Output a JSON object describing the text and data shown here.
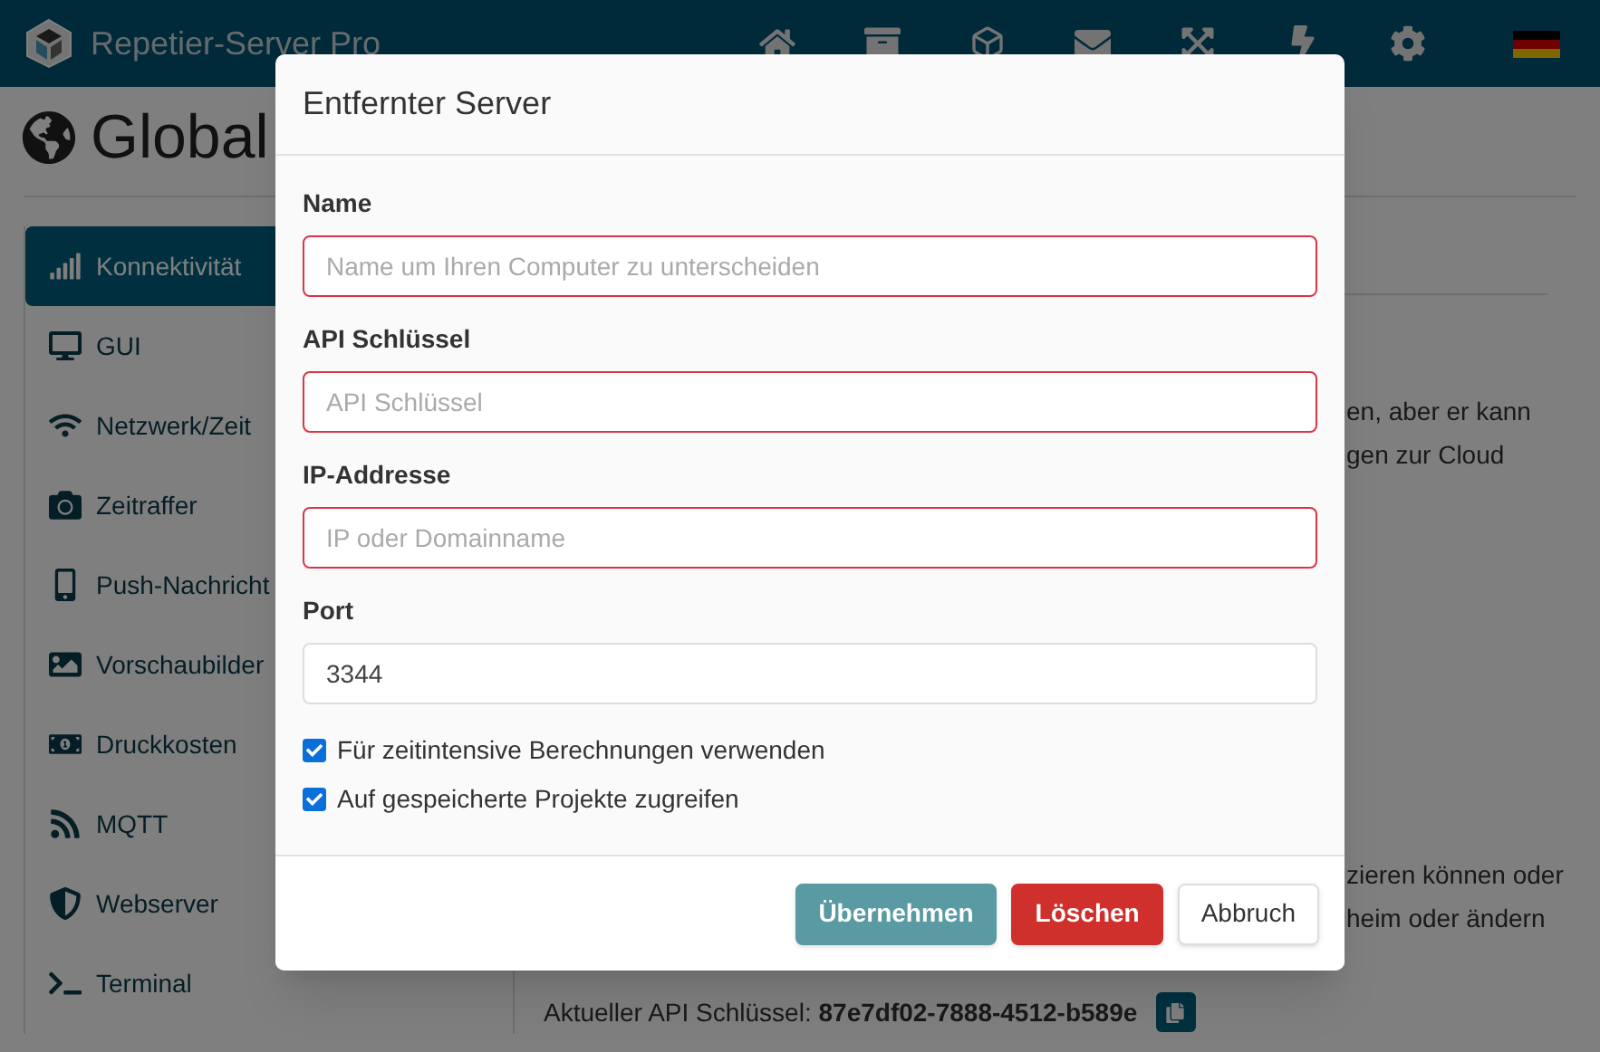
{
  "header": {
    "title": "Repetier-Server Pro"
  },
  "page_title": "Global",
  "sidebar": {
    "items": [
      {
        "label": "Konnektivität",
        "selected": true
      },
      {
        "label": "GUI",
        "selected": false
      },
      {
        "label": "Netzwerk/Zeit",
        "selected": false
      },
      {
        "label": "Zeitraffer",
        "selected": false
      },
      {
        "label": "Push-Nachricht",
        "selected": false
      },
      {
        "label": "Vorschaubilder",
        "selected": false
      },
      {
        "label": "Druckkosten",
        "selected": false
      },
      {
        "label": "MQTT",
        "selected": false
      },
      {
        "label": "Webserver",
        "selected": false
      },
      {
        "label": "Terminal",
        "selected": false
      }
    ]
  },
  "content": {
    "fragments_top": [
      "en, aber er kann",
      "gen zur Cloud"
    ],
    "fragments_bottom": [
      "zieren können oder",
      "heim oder ändern"
    ],
    "api_key_line": "Aktueller API Schlüssel: **87e7df02-7888-4512-b589e**"
  },
  "dialog": {
    "title": "Entfernter Server",
    "fields": [
      {
        "label": "Name",
        "placeholder": "Name um Ihren Computer zu unterscheiden",
        "invalid": true
      },
      {
        "label": "API Schlüssel",
        "placeholder": "API Schlüssel",
        "invalid": true
      },
      {
        "label": "IP-Addresse",
        "placeholder": "IP oder Domainname",
        "invalid": true
      },
      {
        "label": "Port",
        "value": "3344",
        "invalid": false
      }
    ],
    "checkboxes": [
      {
        "label": "Für zeitintensive Berechnungen verwenden",
        "checked": true
      },
      {
        "label": "Auf gespeicherte Projekte zugreifen",
        "checked": true
      }
    ],
    "buttons": [
      {
        "label": "Übernehmen",
        "kind": "primary"
      },
      {
        "label": "Löschen",
        "kind": "danger"
      },
      {
        "label": "Abbruch",
        "kind": "default"
      }
    ]
  }
}
